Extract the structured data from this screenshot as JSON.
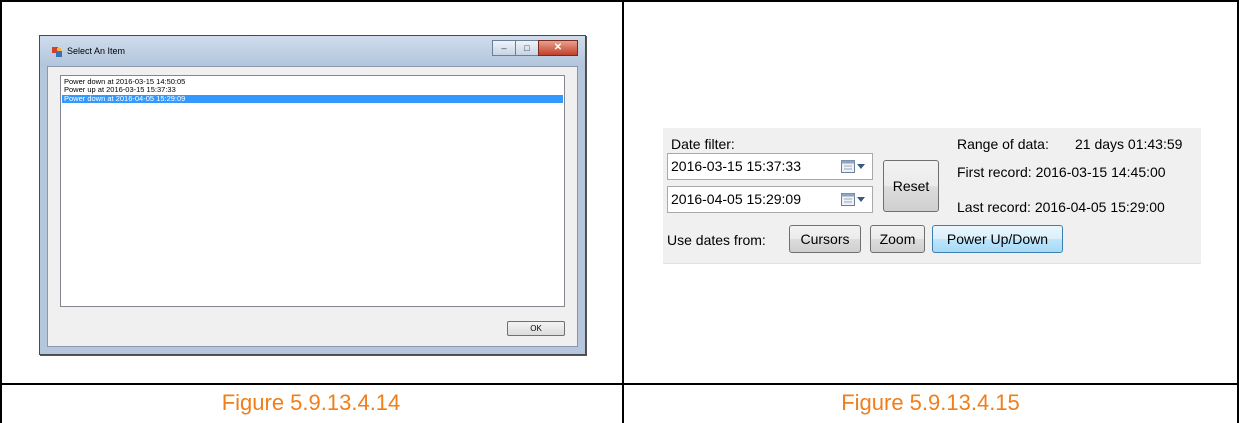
{
  "left": {
    "caption": "Figure 5.9.13.4.14",
    "dialog": {
      "title": "Select An Item",
      "items": [
        {
          "label": "Power down at 2016-03-15 14:50:05",
          "selected": false
        },
        {
          "label": "Power up at 2016-03-15 15:37:33",
          "selected": false
        },
        {
          "label": "Power down at 2016-04-05 15:29:09",
          "selected": true
        }
      ],
      "ok_label": "OK",
      "minimize_symbol": "–",
      "maximize_symbol": "□",
      "close_symbol": "✕"
    }
  },
  "right": {
    "caption": "Figure 5.9.13.4.15",
    "panel": {
      "date_filter_label": "Date filter:",
      "start_date": "2016-03-15 15:37:33",
      "end_date": "2016-04-05 15:29:09",
      "reset_label": "Reset",
      "range_label": "Range of data:",
      "range_value": "21 days 01:43:59",
      "first_record": "First record: 2016-03-15 14:45:00",
      "last_record": "Last record: 2016-04-05 15:29:00",
      "use_dates_label": "Use dates from:",
      "cursors_label": "Cursors",
      "zoom_label": "Zoom",
      "power_label": "Power Up/Down"
    }
  },
  "icons": {
    "app": "app-window-icon",
    "calendar": "calendar-icon",
    "dropdown": "chevron-down-icon"
  },
  "colors": {
    "caption": "#f07e1a",
    "selection": "#3399ff"
  }
}
